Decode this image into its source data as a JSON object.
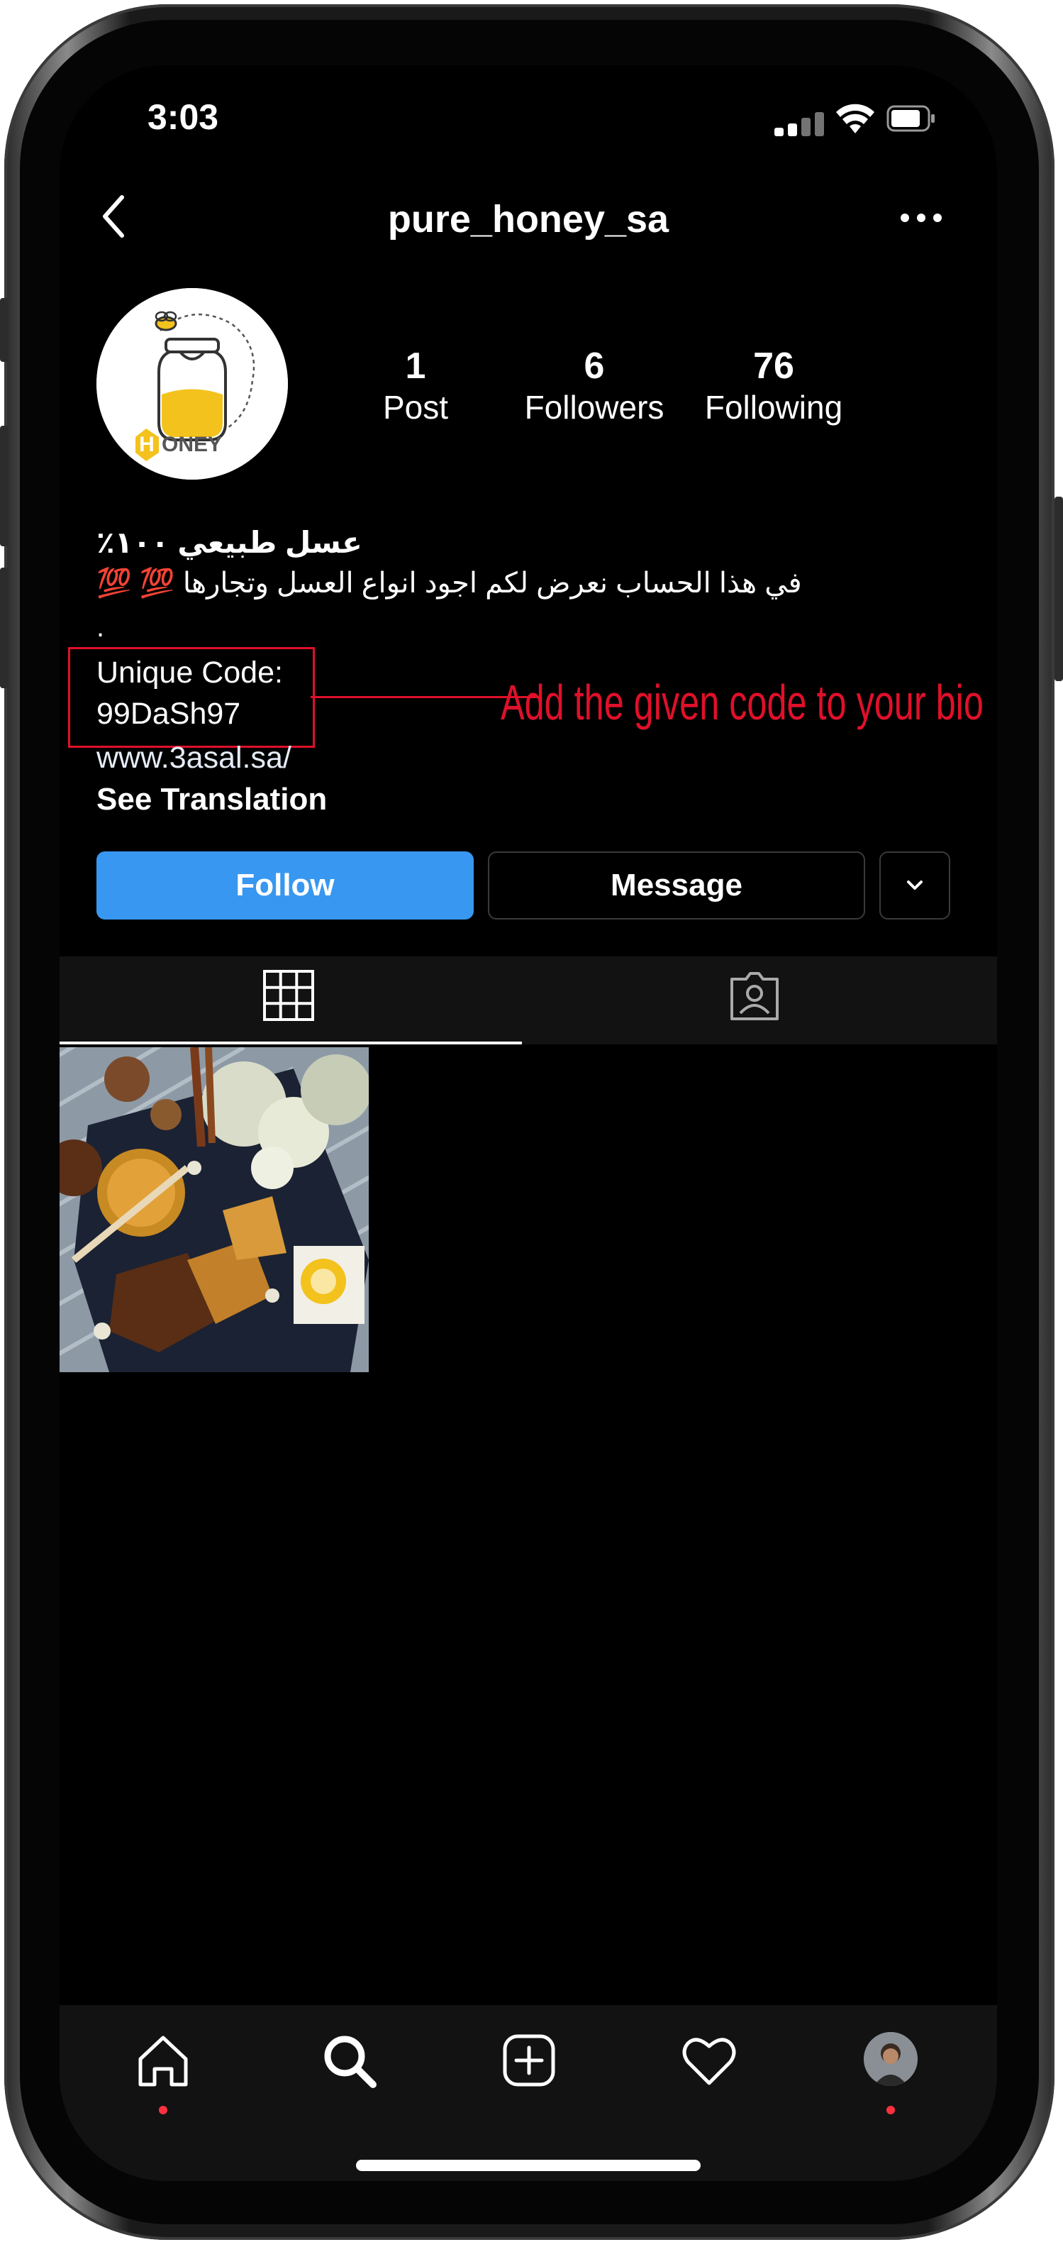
{
  "status_bar": {
    "time": "3:03"
  },
  "header": {
    "username": "pure_honey_sa",
    "back_icon": "chevron-left-icon",
    "more_icon": "more-horizontal-icon"
  },
  "profile": {
    "avatar_text": "ONEY",
    "avatar_letter": "H",
    "stats": [
      {
        "value": "1",
        "label": "Post"
      },
      {
        "value": "6",
        "label": "Followers"
      },
      {
        "value": "76",
        "label": "Following"
      }
    ],
    "bio": {
      "title": "عسل طبيعي ١٠٠٪",
      "description": "في هذا الحساب نعرض لكم اجود انواع العسل وتجارها 💯 💯",
      "dot": ".",
      "code_label": "Unique Code:",
      "code_value": "99DaSh97",
      "link": "www.3asal.sa/",
      "see_translation": "See Translation"
    }
  },
  "annotation": {
    "text": "Add the given code to your bio",
    "color": "#e0102a"
  },
  "actions": {
    "follow": "Follow",
    "message": "Message",
    "dropdown_icon": "chevron-down-icon"
  },
  "tabs": [
    {
      "icon": "grid-icon",
      "active": true
    },
    {
      "icon": "tagged-person-icon",
      "active": false
    }
  ],
  "posts": [
    {
      "alt_icon": "honey-post-thumbnail"
    }
  ],
  "bottom_nav": [
    {
      "icon": "home-icon",
      "dot": true
    },
    {
      "icon": "search-icon",
      "dot": false
    },
    {
      "icon": "add-post-icon",
      "dot": false
    },
    {
      "icon": "heart-icon",
      "dot": false
    },
    {
      "icon": "profile-avatar-icon",
      "dot": true
    }
  ],
  "colors": {
    "follow_button": "#3897f0",
    "background": "#000000",
    "notification_dot": "#ff3040"
  }
}
